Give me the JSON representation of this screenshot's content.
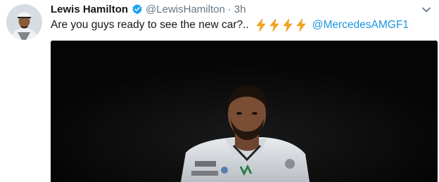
{
  "tweet": {
    "author_name": "Lewis Hamilton",
    "handle": "@LewisHamilton",
    "separator": "·",
    "time": "3h",
    "text": "Are you guys ready to see the new car?..",
    "emoji": [
      "⚡",
      "⚡",
      "⚡",
      "⚡"
    ],
    "mention": "@MercedesAMGF1"
  },
  "colors": {
    "link": "#1b95e0",
    "verified": "#1da1f2",
    "secondary_text": "#657786",
    "bolt": "#f5a623",
    "media_background": "#050505"
  },
  "icons": {
    "verified": "verified-badge-icon",
    "caret": "chevron-down-icon",
    "emoji": "high-voltage-icon"
  }
}
